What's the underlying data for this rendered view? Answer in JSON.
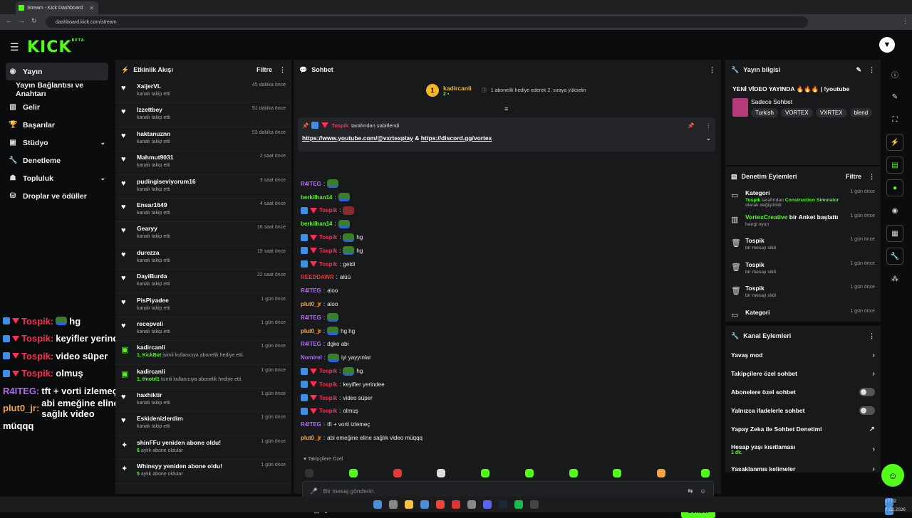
{
  "browser": {
    "tab_title": "Stream - Kick Dashboard",
    "url": "dashboard.kick.com/stream"
  },
  "header": {
    "logo": "KICK",
    "logo_badge": "BETA"
  },
  "nav": [
    {
      "label": "Yayın",
      "icon": "broadcast-icon",
      "active": true
    },
    {
      "label": "Yayın Bağlantısı ve Anahtarı",
      "sub": true
    },
    {
      "label": "Gelir",
      "icon": "chart-icon"
    },
    {
      "label": "Başarılar",
      "icon": "trophy-icon"
    },
    {
      "label": "Stüdyo",
      "icon": "studio-icon",
      "chevron": true
    },
    {
      "label": "Denetleme",
      "icon": "wrench-icon"
    },
    {
      "label": "Topluluk",
      "icon": "people-icon",
      "chevron": true
    },
    {
      "label": "Droplar ve ödüller",
      "icon": "gift-icon"
    }
  ],
  "overlay_chat": [
    {
      "name": "Tospik:",
      "text": "hg",
      "style": "t",
      "badges": true,
      "emote": true
    },
    {
      "name": "Tospik:",
      "text": "keyifler yerindee",
      "style": "t",
      "badges": true
    },
    {
      "name": "Tospik:",
      "text": "video süper",
      "style": "t",
      "badges": true
    },
    {
      "name": "Tospik:",
      "text": "olmuş",
      "style": "t",
      "badges": true
    },
    {
      "name": "R4ITEG:",
      "text": "tft + vorti izlemeç",
      "style": "p"
    },
    {
      "name": "plut0_jr:",
      "text": "abi emeğine eline sağlık video",
      "style": "o"
    },
    {
      "name": "",
      "text": "müqqq",
      "style": ""
    }
  ],
  "activity": {
    "title": "Etkinlik Akışı",
    "filter": "Filtre",
    "items": [
      {
        "name": "XaijerVL",
        "desc": "kanalı takip etti",
        "time": "45 dakika önce"
      },
      {
        "name": "Izzettbey",
        "desc": "kanalı takip etti",
        "time": "51 dakika önce"
      },
      {
        "name": "haktanuznn",
        "desc": "kanalı takip etti",
        "time": "53 dakika önce"
      },
      {
        "name": "Mahmut9031",
        "desc": "kanalı takip etti",
        "time": "2 saat önce"
      },
      {
        "name": "pudingiseviyorum16",
        "desc": "kanalı takip etti",
        "time": "3 saat önce"
      },
      {
        "name": "Ensar1649",
        "desc": "kanalı takip etti",
        "time": "4 saat önce"
      },
      {
        "name": "Gearyy",
        "desc": "kanalı takip etti",
        "time": "16 saat önce"
      },
      {
        "name": "durezza",
        "desc": "kanalı takip etti",
        "time": "19 saat önce"
      },
      {
        "name": "DayiBurda",
        "desc": "kanalı takip etti",
        "time": "22 saat önce"
      },
      {
        "name": "PisPiyadee",
        "desc": "kanalı takip etti",
        "time": "1 gün önce"
      },
      {
        "name": "recepveli",
        "desc": "kanalı takip etti",
        "time": "1 gün önce"
      },
      {
        "name": "kadircanli",
        "desc_pre": "1, KickBot",
        "desc": "isimli kullanıcıya abonelik hediye etti.",
        "time": "1 gün önce",
        "gift": true
      },
      {
        "name": "kadircanli",
        "desc_pre": "1, tfnotrl1",
        "desc": "isimli kullanıcıya abonelik hediye etti.",
        "time": "1 gün önce",
        "gift": true
      },
      {
        "name": "haxhiktir",
        "desc": "kanalı takip etti",
        "time": "1 gün önce"
      },
      {
        "name": "Eskidenizlerdim",
        "desc": "kanalı takip etti",
        "time": "1 gün önce"
      },
      {
        "name": "shinFFu yeniden abone oldu!",
        "desc_pre": "6",
        "desc": "aylık abone oldular",
        "time": "1 gün önce",
        "star": true
      },
      {
        "name": "Whinsyy yeniden abone oldu!",
        "desc_pre": "5",
        "desc": "aylık abone oldular",
        "time": "1 gün önce",
        "star": true
      }
    ]
  },
  "chat": {
    "title": "Sohbet",
    "sub_event": {
      "user": "kadircanli",
      "count": "2",
      "text": "1 abonelik hediye ederek 2. sıraya yükselin",
      "badge": "1"
    },
    "pinned": {
      "by": "Tospik",
      "label": "tarafından sabitlendi",
      "link1": "https://www.youtube.com/@vxrtexplay",
      "amp": "&",
      "link2": "https://discord.gg/vortex"
    },
    "messages": [
      {
        "user": "R4ITEG",
        "text": "",
        "color": "p",
        "emote": true
      },
      {
        "user": "berkilhan14",
        "text": "",
        "color": "g",
        "emote": true
      },
      {
        "user": "Tospik",
        "text": "",
        "color": "t",
        "badges": true,
        "emote": true,
        "red": true
      },
      {
        "user": "berkilhan14",
        "text": "",
        "color": "g",
        "emote": true
      },
      {
        "user": "Tospik",
        "text": "hg",
        "color": "t",
        "badges": true,
        "emote": true
      },
      {
        "user": "Tospik",
        "text": "hg",
        "color": "t",
        "badges": true,
        "emote": true
      },
      {
        "user": "Tospik",
        "text": "geldi",
        "color": "t",
        "badges": true
      },
      {
        "user": "REEDDAWR",
        "text": "alüü",
        "color": "r"
      },
      {
        "user": "R4ITEG",
        "text": "aloo",
        "color": "p"
      },
      {
        "user": "plut0_jr",
        "text": "aloo",
        "color": "o"
      },
      {
        "user": "R4ITEG",
        "text": "",
        "color": "p",
        "emote": true
      },
      {
        "user": "plut0_jr",
        "text": "hg hg",
        "color": "o",
        "emote": true
      },
      {
        "user": "R4ITEG",
        "text": "dgko abi",
        "color": "p"
      },
      {
        "user": "Nomirel",
        "text": "iyi yayyınlar",
        "color": "p",
        "emote": true
      },
      {
        "user": "Tospik",
        "text": "hg",
        "color": "t",
        "badges": true,
        "emote": true
      },
      {
        "user": "Tospik",
        "text": "keyifler yerindee",
        "color": "t",
        "badges": true
      },
      {
        "user": "Tospik",
        "text": "video süper",
        "color": "t",
        "badges": true
      },
      {
        "user": "Tospik",
        "text": "olmuş",
        "color": "t",
        "badges": true
      },
      {
        "user": "R4ITEG",
        "text": "tft + vorti izlemeç",
        "color": "p"
      },
      {
        "user": "plut0_jr",
        "text": "abi emeğine eline sağlık video müqqq",
        "color": "o"
      }
    ],
    "followers_only": "Takipçilere Özel",
    "input_placeholder": "Bir mesaj gönderin",
    "points": "0",
    "send": "Gönder"
  },
  "stream_info": {
    "title": "Yayın bilgisi",
    "stream_title": "YENİ VİDEO YAYINDA 🔥🔥🔥 | !youtube",
    "mode": "Sadece Sohbet",
    "tags": [
      "Turkish",
      "VORTEX",
      "VXRTEX",
      "blend"
    ]
  },
  "mod_actions": {
    "title": "Denetim Eylemleri",
    "filter": "Filtre",
    "items": [
      {
        "title": "Kategori",
        "who": "Tospik",
        "mid": "tarafından",
        "cat": "Construction Simulator",
        "end": "olarak değiştirildi",
        "time": "1 gün önce",
        "icon": "category-icon"
      },
      {
        "title": "VortexCreative",
        "title_rest": "bir Anket başlattı",
        "desc": "hangi oyun",
        "time": "1 gün önce",
        "icon": "poll-icon",
        "green": true
      },
      {
        "title": "Tospik",
        "desc": "bir mesajı sildi",
        "time": "1 gün önce",
        "icon": "trash-icon"
      },
      {
        "title": "Tospik",
        "desc": "bir mesajı sildi",
        "time": "1 gün önce",
        "icon": "trash-icon"
      },
      {
        "title": "Tospik",
        "desc": "bir mesajı sildi",
        "time": "1 gün önce",
        "icon": "trash-icon"
      },
      {
        "title": "Kategori",
        "desc": "",
        "time": "1 gün önce",
        "icon": "category-icon"
      }
    ]
  },
  "channel_actions": {
    "title": "Kanal Eylemleri",
    "items": [
      {
        "label": "Yavaş mod",
        "type": "chevron"
      },
      {
        "label": "Takipçilere özel sohbet",
        "type": "chevron"
      },
      {
        "label": "Abonelere özel sohbet",
        "type": "toggle"
      },
      {
        "label": "Yalnızca ifadelerle sohbet",
        "type": "toggle"
      },
      {
        "label": "Yapay Zeka ile Sohbet Denetimi",
        "type": "external"
      },
      {
        "label": "Hesap yaşı kısıtlaması",
        "sub": "1 dk.",
        "type": "chevron"
      },
      {
        "label": "Yasaklanmış kelimeler",
        "type": "chevron"
      }
    ]
  },
  "taskbar": {
    "time": "17:02",
    "date": "7.02.2026"
  }
}
